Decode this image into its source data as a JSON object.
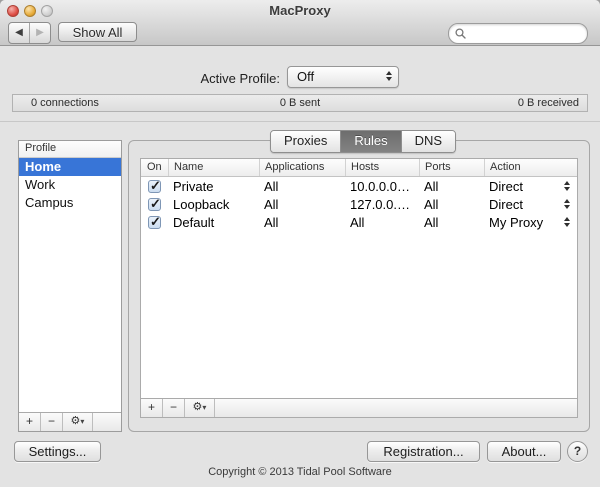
{
  "window": {
    "title": "MacProxy"
  },
  "colors": {
    "selection_blue": "#3875d7",
    "close_red": "#dd4a41",
    "minimize_yellow": "#e6a935",
    "zoom_disabled_gray": "#cfcfcf",
    "active_tab_gray": "#787878"
  },
  "toolbar": {
    "back_icon": "◀",
    "forward_icon": "▶",
    "show_all": "Show All",
    "search_placeholder": ""
  },
  "active_profile": {
    "label": "Active Profile:",
    "value": "Off"
  },
  "status": {
    "connections": "0 connections",
    "sent": "0 B sent",
    "received": "0 B received"
  },
  "sidebar": {
    "header": "Profile",
    "items": [
      {
        "label": "Home"
      },
      {
        "label": "Work"
      },
      {
        "label": "Campus"
      }
    ],
    "toolbar": {
      "add": "+",
      "remove": "−",
      "gear": "⚙",
      "dropdown": "▾"
    }
  },
  "tabs": [
    {
      "label": "Proxies"
    },
    {
      "label": "Rules"
    },
    {
      "label": "DNS"
    }
  ],
  "rules_table": {
    "columns": [
      "On",
      "Name",
      "Applications",
      "Hosts",
      "Ports",
      "Action"
    ],
    "rows": [
      {
        "on": "✓",
        "name": "Private",
        "applications": "All",
        "hosts": "10.0.0.0…",
        "ports": "All",
        "action": "Direct"
      },
      {
        "on": "✓",
        "name": "Loopback",
        "applications": "All",
        "hosts": "127.0.0.…",
        "ports": "All",
        "action": "Direct"
      },
      {
        "on": "✓",
        "name": "Default",
        "applications": "All",
        "hosts": "All",
        "ports": "All",
        "action": "My Proxy"
      }
    ],
    "toolbar": {
      "add": "+",
      "remove": "−",
      "gear": "⚙",
      "dropdown": "▾"
    }
  },
  "buttons": {
    "settings": "Settings...",
    "registration": "Registration...",
    "about": "About...",
    "help": "?"
  },
  "footer": {
    "copyright": "Copyright © 2013 Tidal Pool Software"
  }
}
